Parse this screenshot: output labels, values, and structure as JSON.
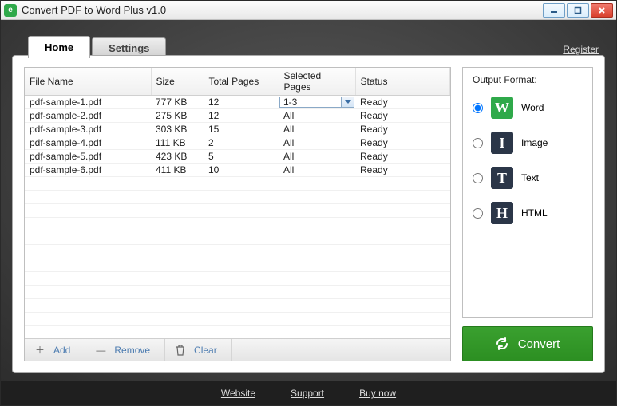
{
  "window": {
    "title": "Convert PDF to Word Plus v1.0"
  },
  "links": {
    "register": "Register"
  },
  "tabs": {
    "home": "Home",
    "settings": "Settings",
    "active": "home"
  },
  "table": {
    "headers": {
      "file": "File Name",
      "size": "Size",
      "pages": "Total Pages",
      "selected": "Selected Pages",
      "status": "Status"
    },
    "rows": [
      {
        "file": "pdf-sample-1.pdf",
        "size": "777 KB",
        "pages": "12",
        "selected": "1-3",
        "status": "Ready",
        "editing": true
      },
      {
        "file": "pdf-sample-2.pdf",
        "size": "275 KB",
        "pages": "12",
        "selected": "All",
        "status": "Ready"
      },
      {
        "file": "pdf-sample-3.pdf",
        "size": "303 KB",
        "pages": "15",
        "selected": "All",
        "status": "Ready"
      },
      {
        "file": "pdf-sample-4.pdf",
        "size": "111 KB",
        "pages": "2",
        "selected": "All",
        "status": "Ready"
      },
      {
        "file": "pdf-sample-5.pdf",
        "size": "423 KB",
        "pages": "5",
        "selected": "All",
        "status": "Ready"
      },
      {
        "file": "pdf-sample-6.pdf",
        "size": "411 KB",
        "pages": "10",
        "selected": "All",
        "status": "Ready"
      }
    ]
  },
  "toolbar": {
    "add": "Add",
    "remove": "Remove",
    "clear": "Clear"
  },
  "output": {
    "title": "Output Format:",
    "options": {
      "word": {
        "label": "Word",
        "glyph": "W"
      },
      "image": {
        "label": "Image",
        "glyph": "I"
      },
      "text": {
        "label": "Text",
        "glyph": "T"
      },
      "html": {
        "label": "HTML",
        "glyph": "H"
      }
    },
    "selected": "word"
  },
  "buttons": {
    "convert": "Convert"
  },
  "footer": {
    "website": "Website",
    "support": "Support",
    "buy": "Buy now"
  }
}
